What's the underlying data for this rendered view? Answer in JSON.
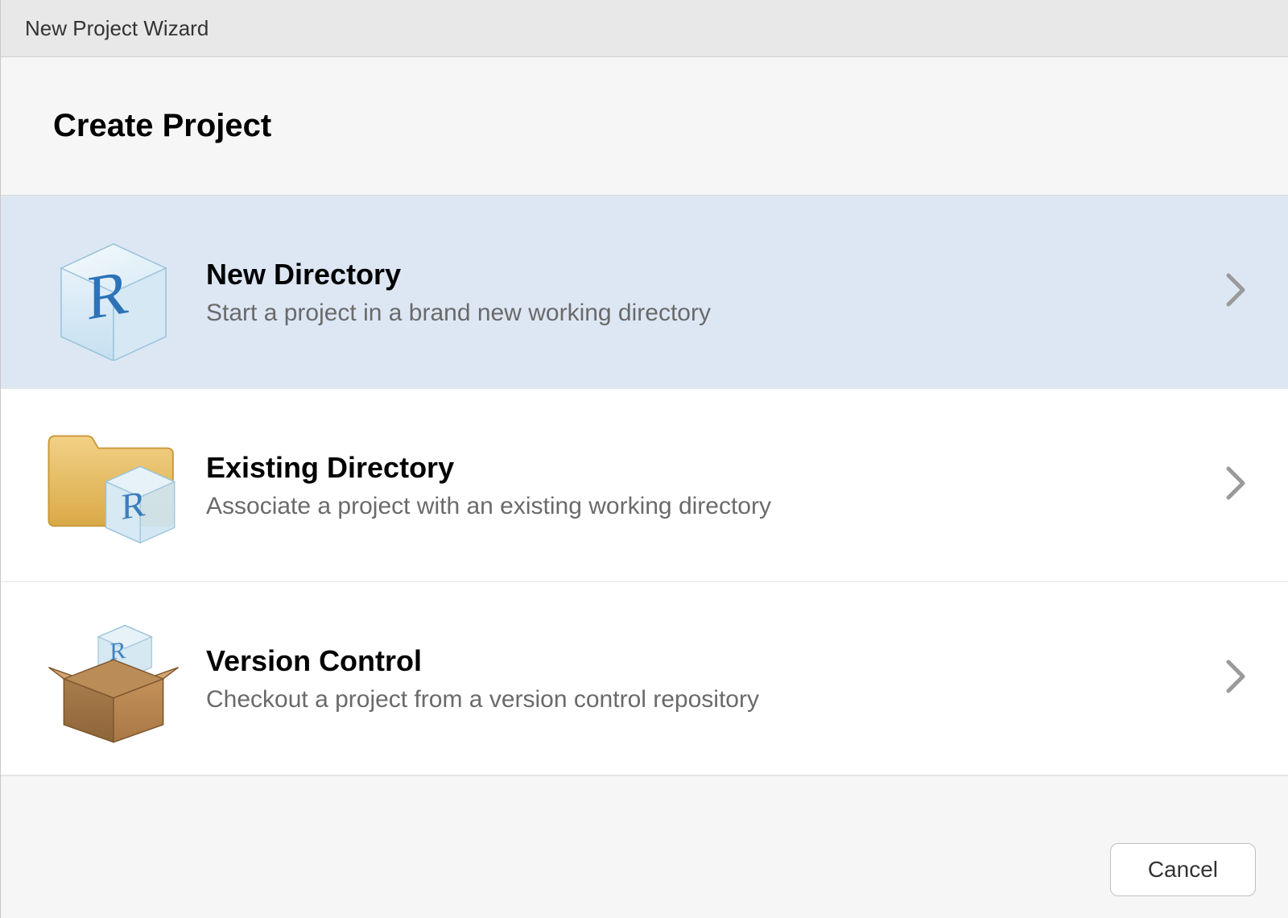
{
  "titlebar": "New Project Wizard",
  "header": "Create Project",
  "options": [
    {
      "title": "New Directory",
      "desc": "Start a project in a brand new working directory",
      "selected": true,
      "icon": "cube-r-icon"
    },
    {
      "title": "Existing Directory",
      "desc": "Associate a project with an existing working directory",
      "selected": false,
      "icon": "folder-cube-icon"
    },
    {
      "title": "Version Control",
      "desc": "Checkout a project from a version control repository",
      "selected": false,
      "icon": "package-box-icon"
    }
  ],
  "footer": {
    "cancel_label": "Cancel"
  }
}
